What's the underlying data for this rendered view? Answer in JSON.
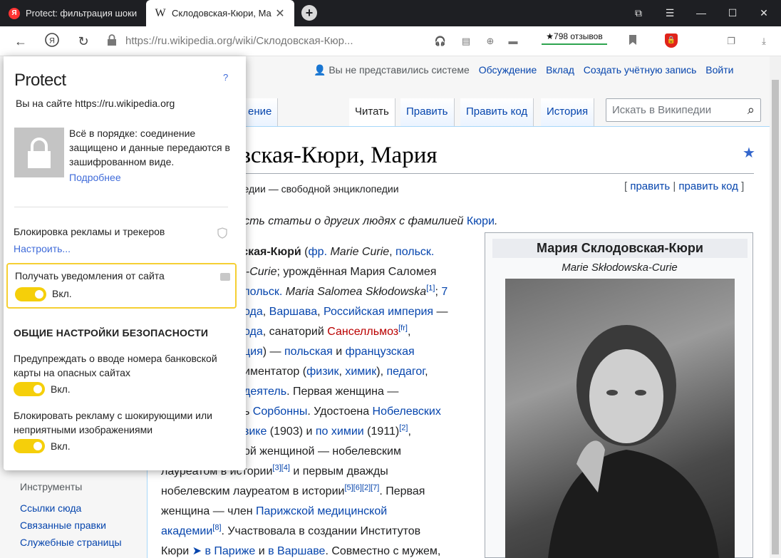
{
  "tabs": [
    {
      "title": "Protect: фильтрация шоки",
      "favicon": "Я"
    },
    {
      "title": "Склодовская-Кюри, Ма",
      "favicon": "W"
    }
  ],
  "address": {
    "url": "https://ru.wikipedia.org/wiki/Склодовская-Кюр...",
    "reviews": "★798 отзывов"
  },
  "wiki": {
    "userbar": {
      "anon": "Вы не представились системе",
      "talk": "Обсуждение",
      "contrib": "Вклад",
      "create": "Создать учётную запись",
      "login": "Войти"
    },
    "tabs": {
      "article_fragment": "ение",
      "read": "Читать",
      "edit": "Править",
      "edit_code": "Править код",
      "history": "История"
    },
    "search_placeholder": "Искать в Википедии",
    "title_fragment": "овская-Кюри, Мария",
    "from_fragment": "кипедии — свободной энциклопедии",
    "edit_links": {
      "edit": "править",
      "edit_code": "править код"
    },
    "hatnote": {
      "text": "и есть статьи о других людях с фамилией ",
      "link": "Кюри",
      "end": "."
    },
    "infobox": {
      "title": "Мария Склодовская-Кюри",
      "subtitle": "Marie Skłodowska-Curie"
    },
    "tools": {
      "heading": "Инструменты",
      "links": [
        "Ссылки сюда",
        "Связанные правки",
        "Служебные страницы"
      ]
    },
    "paragraph": {
      "l1": {
        "a": "о́вская-Кюри́",
        "b": " (",
        "c": "фр.",
        "d": " Marie Curie",
        "e": ", ",
        "f": "польск."
      },
      "l2": {
        "a": "ska-Curie",
        "b": "; урождённая Мария Саломея"
      },
      "l3": {
        "a": "польск.",
        "b": " Maria Salomea Skłodowska",
        "c": "[1]",
        "d": "; ",
        "e": "7"
      },
      "l4": {
        "a": "ода",
        "b": ", ",
        "c": "Варшава",
        "d": ", ",
        "e": "Российская империя",
        "f": " —"
      },
      "l5": {
        "a": "ода",
        "b": ", санаторий ",
        "c": "Санселльмоз",
        "d": "[fr]",
        "e": ","
      },
      "l6": {
        "a": "ция",
        "b": ") — ",
        "c": "польская",
        "d": " и ",
        "e": "французская"
      },
      "l7": {
        "a": "иментатор (",
        "b": "физик",
        "c": ", ",
        "d": "химик",
        "e": "), ",
        "f": "педагог",
        "g": ","
      },
      "l8": {
        "a": "деятель",
        "b": ". Первая женщина —"
      },
      "l9": {
        "a": "ь ",
        "b": "Сорбонны",
        "c": ". Удостоена ",
        "d": "Нобелевских"
      },
      "l10": {
        "a": "зике",
        "b": " (1903) и ",
        "c": "по химии",
        "d": " (1911)",
        "e": "[2]",
        "f": ","
      },
      "l11": {
        "a": "ой женщиной — нобелевским"
      },
      "l12": {
        "a": "лауреатом в истории",
        "b": "[3][4]",
        "c": " и первым дважды"
      },
      "l13": {
        "a": "нобелевским лауреатом в истории",
        "b": "[5][6][2][7]",
        "c": ". Первая"
      },
      "l14": {
        "a": "женщина — член ",
        "b": "Парижской медицинской"
      },
      "l15": {
        "a": "академии",
        "b": "[8]",
        "c": ". Участвовала в создании Институтов"
      },
      "l16": {
        "a": "Кюри ",
        "b": "➤",
        "c": " в Париже",
        "d": " и ",
        "e": "в Варшаве",
        "f": ". Совместно с мужем,"
      }
    }
  },
  "protect": {
    "title": "Protect",
    "help": "?",
    "site": "Вы на сайте https://ru.wikipedia.org",
    "connection": "Всё в порядке: соединение защищено и данные передаются в зашифрованном виде.",
    "more": "Подробнее",
    "adblock": "Блокировка рекламы и трекеров",
    "configure": "Настроить...",
    "notifications": {
      "label": "Получать уведомления от сайта",
      "state": "Вкл.",
      "on": true
    },
    "heading": "ОБЩИЕ НАСТРОЙКИ БЕЗОПАСНОСТИ",
    "bank": {
      "label": "Предупреждать о вводе номера банковской карты на опасных сайтах",
      "state": "Вкл.",
      "on": true
    },
    "shock": {
      "label": "Блокировать рекламу с шокирующими или неприятными изображениями",
      "state": "Вкл.",
      "on": true
    }
  },
  "colors": {
    "accent": "#f5cf0a",
    "link": "#0645ad",
    "popup_link": "#3f6bd9"
  }
}
